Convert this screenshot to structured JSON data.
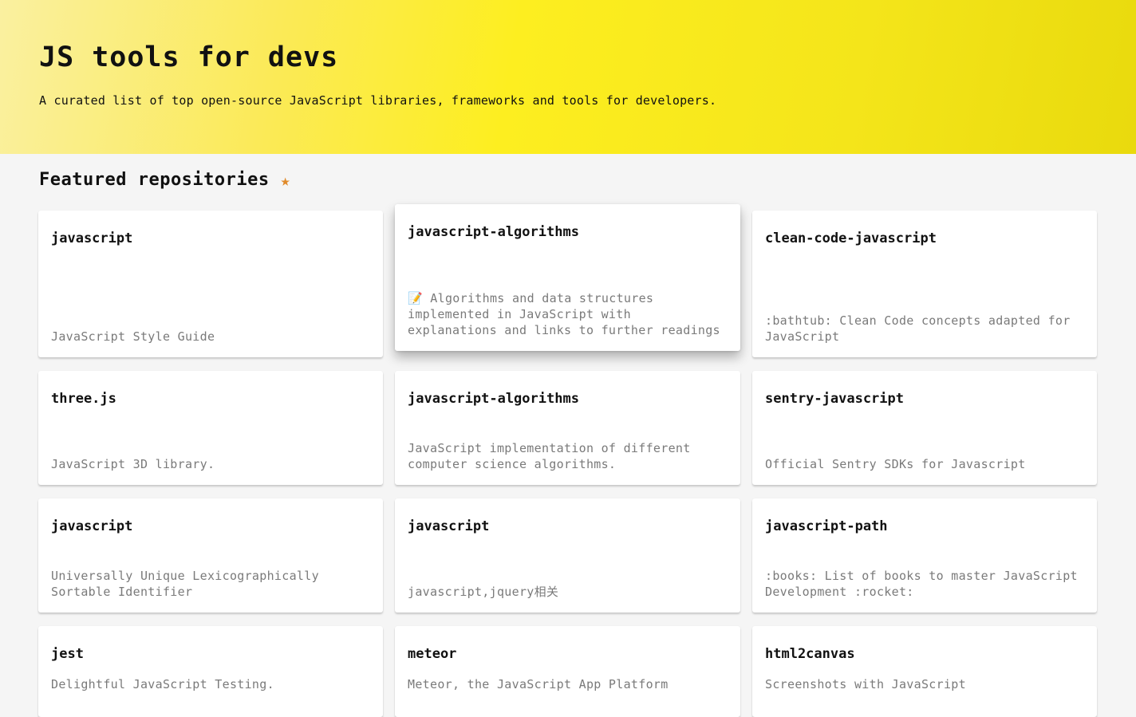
{
  "hero": {
    "title": "JS tools for devs",
    "subtitle": "A curated list of top open-source JavaScript libraries, frameworks and tools for developers."
  },
  "featured": {
    "title": "Featured repositories",
    "icon": "star-icon",
    "icon_color": "#e08a2a"
  },
  "repos": [
    {
      "name": "javascript",
      "description": "JavaScript Style Guide"
    },
    {
      "name": "javascript-algorithms",
      "description": "📝 Algorithms and data structures implemented in JavaScript with explanations and links to further readings"
    },
    {
      "name": "clean-code-javascript",
      "description": ":bathtub: Clean Code concepts adapted for JavaScript"
    },
    {
      "name": "three.js",
      "description": "JavaScript 3D library."
    },
    {
      "name": "javascript-algorithms",
      "description": "JavaScript implementation of different computer science algorithms."
    },
    {
      "name": "sentry-javascript",
      "description": "Official Sentry SDKs for Javascript"
    },
    {
      "name": "javascript",
      "description": "Universally Unique Lexicographically Sortable Identifier"
    },
    {
      "name": "javascript",
      "description": "javascript,jquery相关"
    },
    {
      "name": "javascript-path",
      "description": ":books: List of books to master JavaScript Development :rocket:"
    },
    {
      "name": "jest",
      "description": "Delightful JavaScript Testing."
    },
    {
      "name": "meteor",
      "description": "Meteor, the JavaScript App Platform"
    },
    {
      "name": "html2canvas",
      "description": "Screenshots with JavaScript"
    }
  ]
}
